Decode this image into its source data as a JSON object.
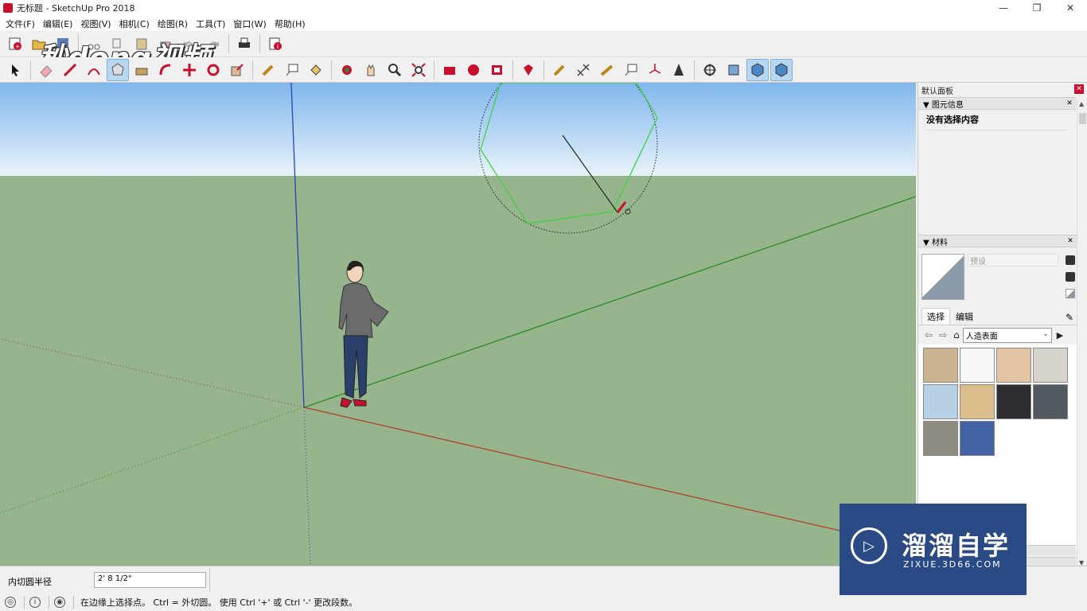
{
  "window": {
    "title": "无标题 - SketchUp Pro 2018",
    "minimize": "—",
    "restore": "❐",
    "close": "✕"
  },
  "menu": [
    "文件(F)",
    "编辑(E)",
    "视图(V)",
    "相机(C)",
    "绘图(R)",
    "工具(T)",
    "窗口(W)",
    "帮助(H)"
  ],
  "watermark_top": "秒dong视频",
  "toolbar1": [
    "new-model-icon",
    "open-icon",
    "save-icon",
    "cut-icon",
    "copy-icon",
    "paste-icon",
    "erase-icon",
    "undo-icon",
    "redo-icon",
    "print-icon",
    "model-info-icon"
  ],
  "toolbar2": [
    {
      "icon": "select-icon"
    },
    {
      "icon": "eraser-icon"
    },
    {
      "icon": "line-icon"
    },
    {
      "icon": "arc-icon"
    },
    {
      "icon": "polygon-icon",
      "active": true
    },
    {
      "icon": "push-pull-icon"
    },
    {
      "icon": "follow-me-icon"
    },
    {
      "icon": "move-icon"
    },
    {
      "icon": "rotate-icon"
    },
    {
      "icon": "scale-icon"
    },
    {
      "icon": "tape-measure-icon"
    },
    {
      "icon": "text-icon"
    },
    {
      "icon": "paint-bucket-icon"
    },
    {
      "icon": "orbit-icon"
    },
    {
      "icon": "pan-icon"
    },
    {
      "icon": "zoom-icon"
    },
    {
      "icon": "zoom-extents-icon"
    },
    {
      "icon": "warehouse-icon"
    },
    {
      "icon": "extension-warehouse-icon"
    },
    {
      "icon": "layout-icon"
    },
    {
      "icon": "ruby-icon"
    },
    {
      "icon": "tape-measure-icon"
    },
    {
      "icon": "dimension-icon"
    },
    {
      "icon": "protractor-icon"
    },
    {
      "icon": "3d-text-icon"
    },
    {
      "icon": "axes-icon"
    },
    {
      "icon": "section-icon"
    },
    {
      "icon": "position-camera-icon"
    },
    {
      "icon": "walk-icon"
    },
    {
      "icon": "look-around-icon",
      "active": true
    },
    {
      "icon": "iso-view-icon",
      "active": true
    }
  ],
  "panel": {
    "title": "默认面板",
    "entity_info": {
      "header": "▼ 图元信息",
      "body": "没有选择内容"
    },
    "materials": {
      "header": "▼ 材料",
      "name_placeholder": "预设",
      "tabs": [
        "选择",
        "编辑"
      ],
      "collection": "人造表面",
      "swatches": [
        "#cbb48f",
        "#f7f7f7",
        "#e2c3a2",
        "#d7d2cc",
        "#b6d1e6",
        "#dcbd8c",
        "#2c2e31",
        "#525a60",
        "#8e8c82",
        "#4362a4"
      ]
    }
  },
  "vcb": {
    "label": "内切圆半径",
    "value": "2' 8 1/2\""
  },
  "status": {
    "text": "在边缘上选择点。 Ctrl = 外切圆。 使用 Ctrl '+' 或 Ctrl '-' 更改段数。"
  },
  "watermark": {
    "cn": "溜溜自学",
    "url": "ZIXUE.3D66.COM"
  }
}
